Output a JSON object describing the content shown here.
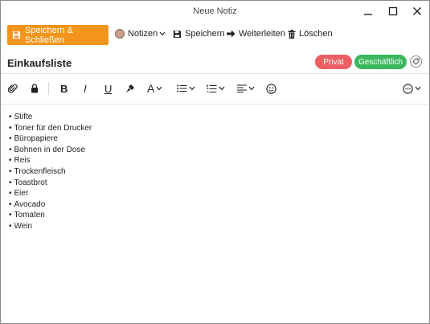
{
  "window": {
    "title": "Neue Notiz"
  },
  "toolbar": {
    "save_close_label": "Speichern & Schließen",
    "notes_label": "Notizen",
    "save_label": "Speichern",
    "forward_label": "Weiterleiten",
    "delete_label": "Löschen",
    "accent_color": "#f4951b"
  },
  "note": {
    "subject": "Einkaufsliste",
    "tags": [
      {
        "label": "Privat",
        "color": "#ec5f63"
      },
      {
        "label": "Geschäftlich",
        "color": "#3bb75e"
      }
    ]
  },
  "formatting": {
    "icons": [
      "paperclip-icon",
      "lock-icon",
      "bold-icon",
      "italic-icon",
      "underline-icon",
      "format-painter-icon",
      "font-icon",
      "bullet-list-icon",
      "numbered-list-icon",
      "align-icon",
      "emoji-icon",
      "more-icon"
    ],
    "bold_glyph": "B",
    "italic_glyph": "I",
    "underline_glyph": "U",
    "font_glyph": "A"
  },
  "body": {
    "items": [
      "Stifte",
      "Toner für den Drucker",
      "Büropapiere",
      "Bohnen in der Dose",
      "Reis",
      "Trockenfleisch",
      "Toastbrot",
      "Eier",
      "Avocado",
      "Tomaten",
      "Wein"
    ]
  }
}
